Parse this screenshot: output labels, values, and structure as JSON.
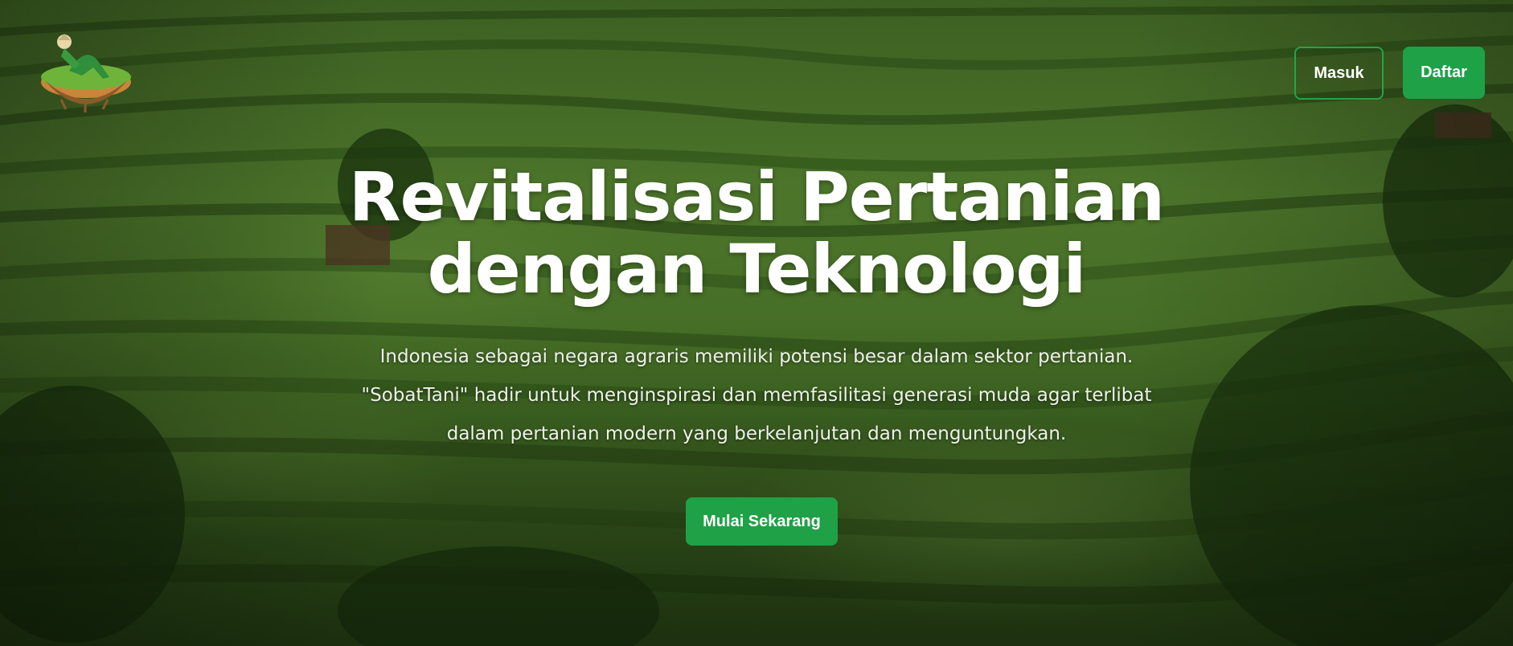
{
  "header": {
    "logo_icon": "farmer-logo-icon",
    "login_label": "Masuk",
    "register_label": "Daftar"
  },
  "hero": {
    "title_line1": "Revitalisasi Pertanian",
    "title_line2": "dengan Teknologi",
    "description": "Indonesia sebagai negara agraris memiliki potensi besar dalam sektor pertanian. \"SobatTani\" hadir untuk menginspirasi dan memfasilitasi generasi muda agar terlibat dalam pertanian modern yang berkelanjutan dan menguntungkan.",
    "cta_label": "Mulai Sekarang"
  },
  "colors": {
    "accent": "#1fa147",
    "text": "#ffffff"
  }
}
